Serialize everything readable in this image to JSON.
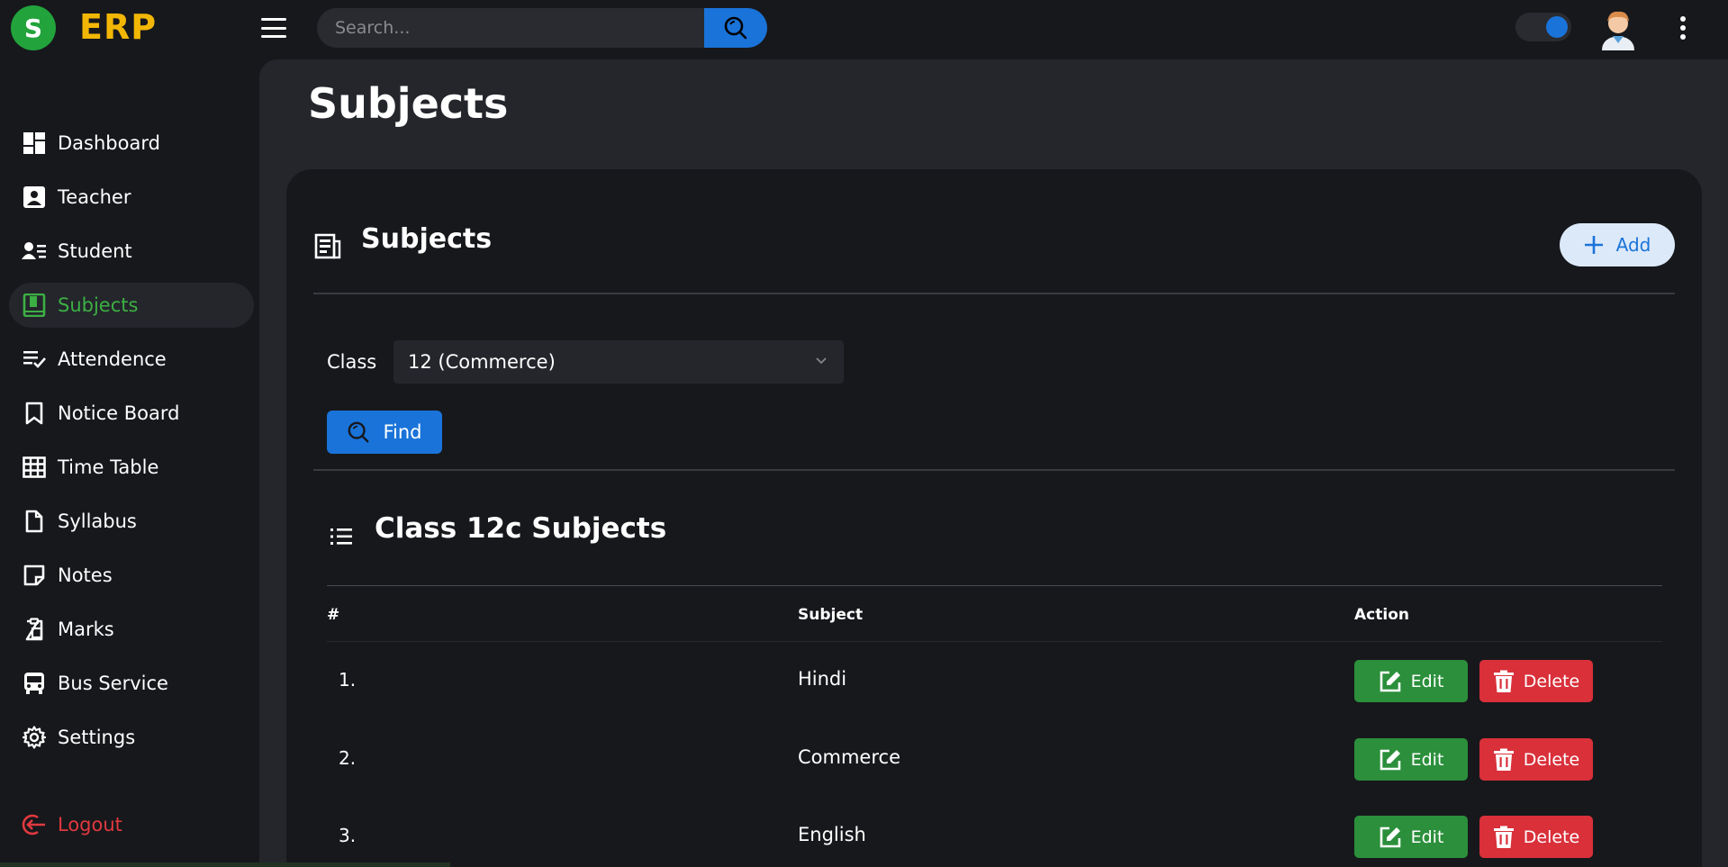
{
  "brand": {
    "logo_letter": "S",
    "name": "ERP"
  },
  "search": {
    "placeholder": "Search..."
  },
  "sidebar": {
    "items": [
      {
        "label": "Dashboard",
        "icon": "dashboard-icon"
      },
      {
        "label": "Teacher",
        "icon": "teacher-icon"
      },
      {
        "label": "Student",
        "icon": "student-icon"
      },
      {
        "label": "Subjects",
        "icon": "subjects-icon",
        "active": true
      },
      {
        "label": "Attendence",
        "icon": "attendance-icon"
      },
      {
        "label": "Notice Board",
        "icon": "bookmark-icon"
      },
      {
        "label": "Time Table",
        "icon": "grid-icon"
      },
      {
        "label": "Syllabus",
        "icon": "file-icon"
      },
      {
        "label": "Notes",
        "icon": "note-icon"
      },
      {
        "label": "Marks",
        "icon": "clipboard-icon"
      },
      {
        "label": "Bus Service",
        "icon": "bus-icon"
      },
      {
        "label": "Settings",
        "icon": "gear-icon"
      }
    ],
    "logout_label": "Logout"
  },
  "page": {
    "title": "Subjects"
  },
  "card": {
    "title": "Subjects",
    "add_label": "Add",
    "class_label": "Class",
    "class_value": "12 (Commerce)",
    "find_label": "Find",
    "list_title": "Class 12c Subjects",
    "columns": [
      "#",
      "Subject",
      "Action"
    ],
    "rows": [
      {
        "num": "1.",
        "subject": "Hindi"
      },
      {
        "num": "2.",
        "subject": "Commerce"
      },
      {
        "num": "3.",
        "subject": "English"
      }
    ],
    "edit_label": "Edit",
    "delete_label": "Delete"
  },
  "colors": {
    "accent_blue": "#1a73d9",
    "brand_yellow": "#f2b705",
    "active_green": "#3cb043",
    "edit_green": "#2b8f3b",
    "delete_red": "#d9303a",
    "logout_red": "#e0393e"
  }
}
